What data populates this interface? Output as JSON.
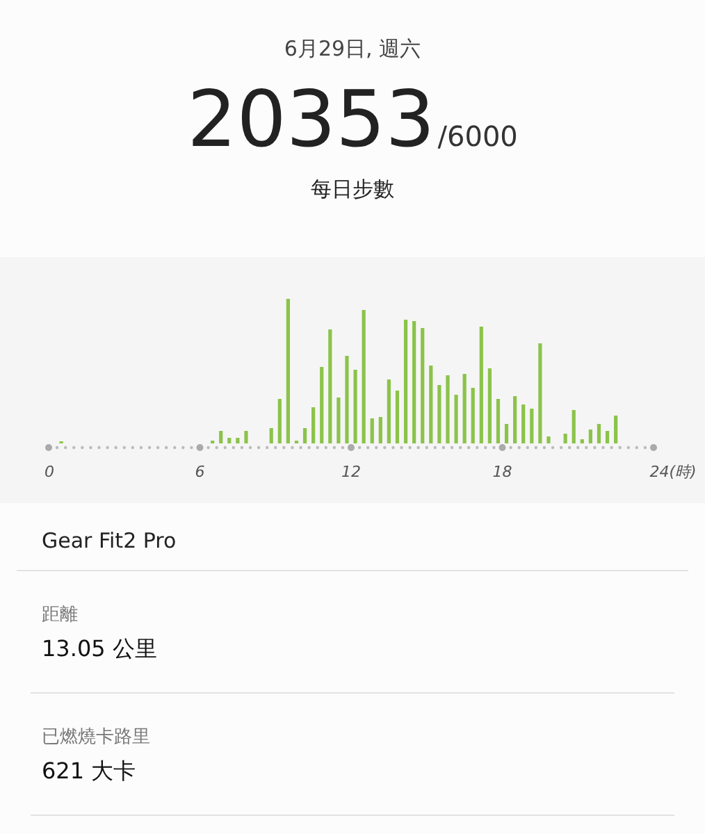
{
  "date": "6月29日, 週六",
  "steps": "20353",
  "goal": "/6000",
  "steps_label": "每日步數",
  "chart": {
    "axis_labels": [
      "0",
      "6",
      "12",
      "18",
      "24(時)"
    ]
  },
  "device": "Gear Fit2 Pro",
  "stats": [
    {
      "label": "距離",
      "value": "13.05 公里"
    },
    {
      "label": "已燃燒卡路里",
      "value": "621 大卡"
    }
  ]
}
